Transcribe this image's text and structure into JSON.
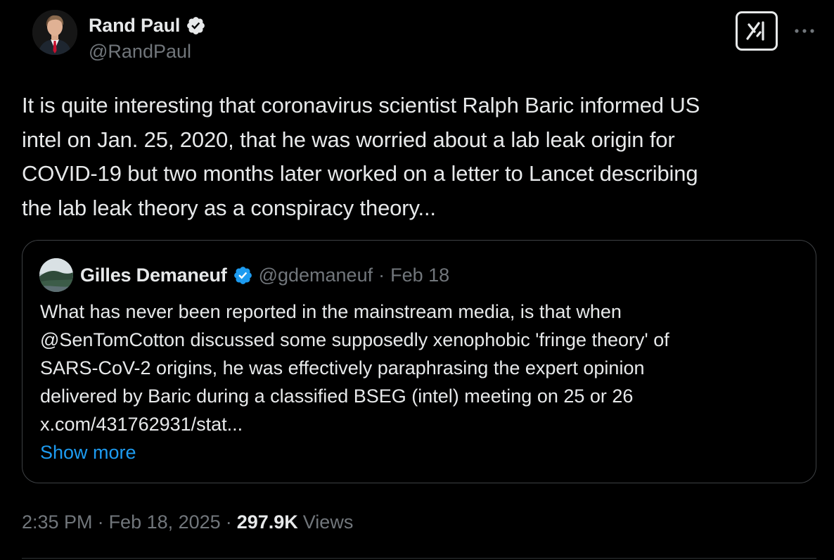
{
  "author": {
    "display_name": "Rand Paul",
    "handle": "@RandPaul",
    "verified": true,
    "verified_color": "#1d9bf0"
  },
  "actions": {
    "grok_icon": "grok-icon",
    "more_icon": "more-dots-icon"
  },
  "tweet": {
    "text": "It is quite interesting that coronavirus scientist Ralph Baric informed US\nintel on Jan. 25, 2020, that he was worried about a lab leak origin for\nCOVID-19 but two months later worked on a letter to Lancet describing\nthe lab leak theory as a conspiracy theory..."
  },
  "quote": {
    "display_name": "Gilles Demaneuf",
    "handle": "@gdemaneuf",
    "separator": "·",
    "date": "Feb 18",
    "verified": true,
    "text": "What has never been reported in the mainstream media, is that when\n@SenTomCotton discussed some supposedly xenophobic 'fringe theory' of\nSARS-CoV-2 origins, he was effectively paraphrasing the expert opinion\ndelivered by Baric during a classified BSEG (intel) meeting on 25 or 26\nx.com/431762931/stat...",
    "show_more": "Show more"
  },
  "meta": {
    "time": "2:35 PM",
    "separator1": "·",
    "date": "Feb 18, 2025",
    "separator2": "·",
    "views_count": "297.9K",
    "views_label": "Views"
  },
  "colors": {
    "background": "#000000",
    "text_primary": "#e7e9ea",
    "text_secondary": "#71767b",
    "link": "#1d9bf0",
    "border": "#3e4144"
  }
}
